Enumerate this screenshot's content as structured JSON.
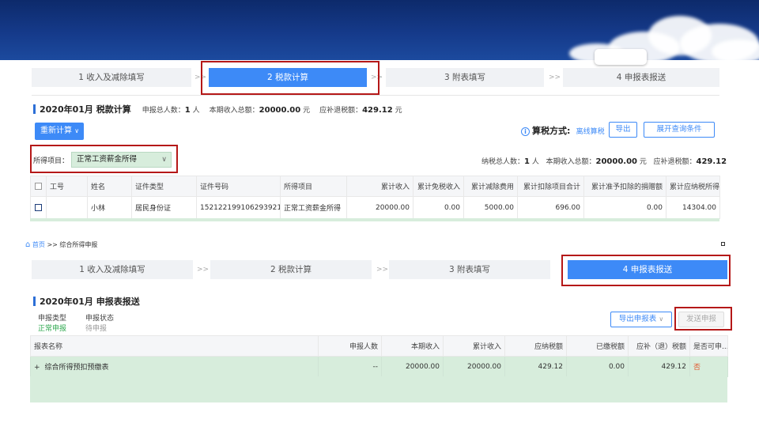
{
  "steps_top": [
    {
      "label": "1 收入及减除填写",
      "active": false
    },
    {
      "label": "2 税款计算",
      "active": true
    },
    {
      "label": "3 附表填写",
      "active": false
    },
    {
      "label": "4 申报表报送",
      "active": false
    }
  ],
  "steps_bottom": [
    {
      "label": "1 收入及减除填写",
      "active": false
    },
    {
      "label": "2 税款计算",
      "active": false
    },
    {
      "label": "3 附表填写",
      "active": false
    },
    {
      "label": "4 申报表报送",
      "active": true
    }
  ],
  "separator": ">>",
  "calc": {
    "period_title": "2020年01月",
    "section_title": "税款计算",
    "summary": {
      "declarants_label": "申报总人数：",
      "declarants_value": "1",
      "declarants_unit": "人",
      "income_label": "本期收入总额：",
      "income_value": "20000.00",
      "income_unit": "元",
      "refund_label": "应补退税额：",
      "refund_value": "429.12",
      "refund_unit": "元"
    },
    "recalc_button": "重新计算",
    "calc_method_label": "算税方式:",
    "calc_method_value": "离线算税",
    "export_button": "导出",
    "expand_query_button": "展开查询条件",
    "income_item_label": "所得项目：",
    "income_item_value": "正常工资薪金所得",
    "right_summary": {
      "taxpayers_label": "纳税总人数：",
      "taxpayers_value": "1",
      "taxpayers_unit": "人",
      "income_label": "本期收入总额：",
      "income_value": "20000.00",
      "income_unit": "元",
      "refund_label": "应补退税额：",
      "refund_value": "429.12"
    },
    "table": {
      "headers": [
        "工号",
        "姓名",
        "证件类型",
        "证件号码",
        "所得项目",
        "累计收入",
        "累计免税收入",
        "累计减除费用",
        "累计扣除项目合计",
        "累计准予扣除的捐赠额",
        "累计应纳税所得额"
      ],
      "row": [
        "",
        "小林",
        "居民身份证",
        "152122199106293921",
        "正常工资薪金所得",
        "20000.00",
        "0.00",
        "5000.00",
        "696.00",
        "0.00",
        "14304.00"
      ]
    }
  },
  "breadcrumb": {
    "home": "首页",
    "separator": ">>",
    "current": "综合所得申报"
  },
  "report": {
    "period_title": "2020年01月",
    "section_title": "申报表报送",
    "type_label": "申报类型",
    "type_value": "正常申报",
    "status_label": "申报状态",
    "status_value": "待申报",
    "export_button": "导出申报表",
    "send_button": "发送申报",
    "table": {
      "headers": [
        "报表名称",
        "申报人数",
        "本期收入",
        "累计收入",
        "应纳税额",
        "已缴税额",
        "应补（退）税额",
        "是否可申..."
      ],
      "row": {
        "expand": "+",
        "name": "综合所得预扣预缴表",
        "count": "--",
        "income": "20000.00",
        "cumulative": "20000.00",
        "tax_due": "429.12",
        "tax_paid": "0.00",
        "refund": "429.12",
        "can_declare": "否"
      }
    }
  },
  "colors": {
    "accent": "#3d8af7",
    "highlight_box": "#b51818",
    "green_row": "#d7eddc",
    "banner": "#153a8a"
  }
}
